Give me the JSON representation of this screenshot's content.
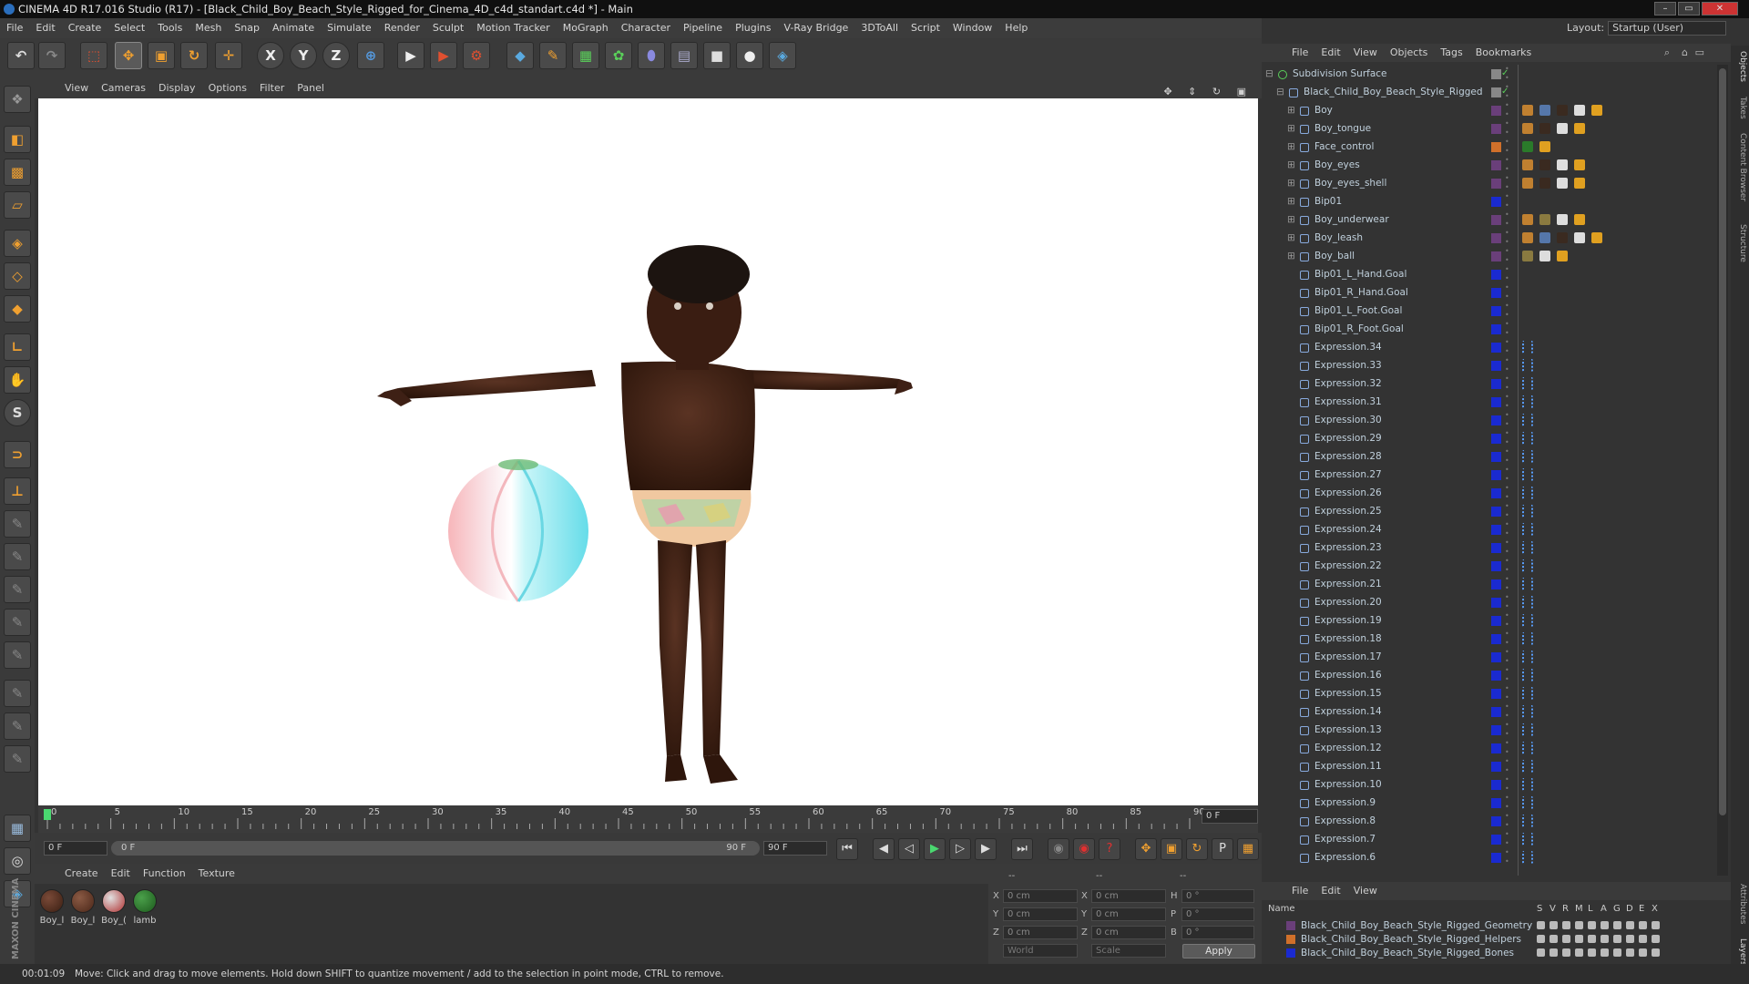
{
  "window": {
    "title": "CINEMA 4D R17.016 Studio (R17) - [Black_Child_Boy_Beach_Style_Rigged_for_Cinema_4D_c4d_standart.c4d *] - Main"
  },
  "menubar": [
    "File",
    "Edit",
    "Create",
    "Select",
    "Tools",
    "Mesh",
    "Snap",
    "Animate",
    "Simulate",
    "Render",
    "Sculpt",
    "Motion Tracker",
    "MoGraph",
    "Character",
    "Pipeline",
    "Plugins",
    "V-Ray Bridge",
    "3DToAll",
    "Script",
    "Window",
    "Help"
  ],
  "layout": {
    "label": "Layout:",
    "value": "Startup (User)"
  },
  "toolbar": {
    "axis_x": "X",
    "axis_y": "Y",
    "axis_z": "Z"
  },
  "viewport_menu": [
    "View",
    "Cameras",
    "Display",
    "Options",
    "Filter",
    "Panel"
  ],
  "timeline": {
    "ticks": [
      "0",
      "5",
      "10",
      "15",
      "20",
      "25",
      "30",
      "35",
      "40",
      "45",
      "50",
      "55",
      "60",
      "65",
      "70",
      "75",
      "80",
      "85",
      "90"
    ],
    "end_frame_field": "0 F"
  },
  "transport": {
    "start_field": "0 F",
    "slider_start": "0 F",
    "slider_end": "90 F",
    "end_field": "90 F"
  },
  "material_menu": [
    "Create",
    "Edit",
    "Function",
    "Texture"
  ],
  "materials": [
    {
      "label": "Boy_l",
      "color": "#3a1e12"
    },
    {
      "label": "Boy_l",
      "color": "#4a2618"
    },
    {
      "label": "Boy_(",
      "color": "#b03030"
    },
    {
      "label": "lamb",
      "color": "#1d5a1d"
    }
  ],
  "coords": {
    "x_label": "X",
    "y_label": "Y",
    "z_label": "Z",
    "pos_x": "0 cm",
    "pos_y": "0 cm",
    "pos_z": "0 cm",
    "size_x": "0 cm",
    "size_y": "0 cm",
    "size_z": "0 cm",
    "h_label": "H",
    "p_label": "P",
    "b_label": "B",
    "rot_h": "0 °",
    "rot_p": "0 °",
    "rot_b": "0 °",
    "mode_world": "World",
    "mode_scale": "Scale",
    "apply": "Apply",
    "header_a": "--",
    "header_b": "--",
    "header_c": "--"
  },
  "object_menu": [
    "File",
    "Edit",
    "View",
    "Objects",
    "Tags",
    "Bookmarks"
  ],
  "objects": [
    {
      "name": "Subdivision Surface",
      "indent": 0,
      "color": "#888888",
      "tags": []
    },
    {
      "name": "Black_Child_Boy_Beach_Style_Rigged",
      "indent": 1,
      "color": "#888888",
      "tags": []
    },
    {
      "name": "Boy",
      "indent": 2,
      "color": "#6a3f7a",
      "tags": [
        "#c08030",
        "#5577aa",
        "#3a2a20",
        "#dddddd",
        "#e0a020"
      ]
    },
    {
      "name": "Boy_tongue",
      "indent": 2,
      "color": "#6a3f7a",
      "tags": [
        "#c08030",
        "#3a2a20",
        "#dddddd",
        "#e0a020"
      ]
    },
    {
      "name": "Face_control",
      "indent": 2,
      "color": "#d0702a",
      "tags": [
        "#2a7a2a",
        "#e0a020"
      ]
    },
    {
      "name": "Boy_eyes",
      "indent": 2,
      "color": "#6a3f7a",
      "tags": [
        "#c08030",
        "#3a2a20",
        "#dddddd",
        "#e0a020"
      ]
    },
    {
      "name": "Boy_eyes_shell",
      "indent": 2,
      "color": "#6a3f7a",
      "tags": [
        "#c08030",
        "#3a2a20",
        "#dddddd",
        "#e0a020"
      ]
    },
    {
      "name": "Bip01",
      "indent": 2,
      "color": "#1a2ad0",
      "tags": []
    },
    {
      "name": "Boy_underwear",
      "indent": 2,
      "color": "#6a3f7a",
      "tags": [
        "#c08030",
        "#8a7a40",
        "#dddddd",
        "#e0a020"
      ]
    },
    {
      "name": "Boy_leash",
      "indent": 2,
      "color": "#6a3f7a",
      "tags": [
        "#c08030",
        "#5577aa",
        "#3a2a20",
        "#dddddd",
        "#e0a020"
      ]
    },
    {
      "name": "Boy_ball",
      "indent": 2,
      "color": "#6a3f7a",
      "tags": [
        "#8a7a40",
        "#dddddd",
        "#e0a020"
      ]
    },
    {
      "name": "Bip01_L_Hand.Goal",
      "indent": 2,
      "color": "#1a2ad0",
      "tags": []
    },
    {
      "name": "Bip01_R_Hand.Goal",
      "indent": 2,
      "color": "#1a2ad0",
      "tags": []
    },
    {
      "name": "Bip01_L_Foot.Goal",
      "indent": 2,
      "color": "#1a2ad0",
      "tags": []
    },
    {
      "name": "Bip01_R_Foot.Goal",
      "indent": 2,
      "color": "#1a2ad0",
      "tags": []
    },
    {
      "name": "Expression.34",
      "indent": 2,
      "color": "#1a2ad0",
      "tags": [
        "xp"
      ]
    },
    {
      "name": "Expression.33",
      "indent": 2,
      "color": "#1a2ad0",
      "tags": [
        "xp"
      ]
    },
    {
      "name": "Expression.32",
      "indent": 2,
      "color": "#1a2ad0",
      "tags": [
        "xp"
      ]
    },
    {
      "name": "Expression.31",
      "indent": 2,
      "color": "#1a2ad0",
      "tags": [
        "xp"
      ]
    },
    {
      "name": "Expression.30",
      "indent": 2,
      "color": "#1a2ad0",
      "tags": [
        "xp"
      ]
    },
    {
      "name": "Expression.29",
      "indent": 2,
      "color": "#1a2ad0",
      "tags": [
        "xp"
      ]
    },
    {
      "name": "Expression.28",
      "indent": 2,
      "color": "#1a2ad0",
      "tags": [
        "xp"
      ]
    },
    {
      "name": "Expression.27",
      "indent": 2,
      "color": "#1a2ad0",
      "tags": [
        "xp"
      ]
    },
    {
      "name": "Expression.26",
      "indent": 2,
      "color": "#1a2ad0",
      "tags": [
        "xp"
      ]
    },
    {
      "name": "Expression.25",
      "indent": 2,
      "color": "#1a2ad0",
      "tags": [
        "xp"
      ]
    },
    {
      "name": "Expression.24",
      "indent": 2,
      "color": "#1a2ad0",
      "tags": [
        "xp"
      ]
    },
    {
      "name": "Expression.23",
      "indent": 2,
      "color": "#1a2ad0",
      "tags": [
        "xp"
      ]
    },
    {
      "name": "Expression.22",
      "indent": 2,
      "color": "#1a2ad0",
      "tags": [
        "xp"
      ]
    },
    {
      "name": "Expression.21",
      "indent": 2,
      "color": "#1a2ad0",
      "tags": [
        "xp"
      ]
    },
    {
      "name": "Expression.20",
      "indent": 2,
      "color": "#1a2ad0",
      "tags": [
        "xp"
      ]
    },
    {
      "name": "Expression.19",
      "indent": 2,
      "color": "#1a2ad0",
      "tags": [
        "xp"
      ]
    },
    {
      "name": "Expression.18",
      "indent": 2,
      "color": "#1a2ad0",
      "tags": [
        "xp"
      ]
    },
    {
      "name": "Expression.17",
      "indent": 2,
      "color": "#1a2ad0",
      "tags": [
        "xp"
      ]
    },
    {
      "name": "Expression.16",
      "indent": 2,
      "color": "#1a2ad0",
      "tags": [
        "xp"
      ]
    },
    {
      "name": "Expression.15",
      "indent": 2,
      "color": "#1a2ad0",
      "tags": [
        "xp"
      ]
    },
    {
      "name": "Expression.14",
      "indent": 2,
      "color": "#1a2ad0",
      "tags": [
        "xp"
      ]
    },
    {
      "name": "Expression.13",
      "indent": 2,
      "color": "#1a2ad0",
      "tags": [
        "xp"
      ]
    },
    {
      "name": "Expression.12",
      "indent": 2,
      "color": "#1a2ad0",
      "tags": [
        "xp"
      ]
    },
    {
      "name": "Expression.11",
      "indent": 2,
      "color": "#1a2ad0",
      "tags": [
        "xp"
      ]
    },
    {
      "name": "Expression.10",
      "indent": 2,
      "color": "#1a2ad0",
      "tags": [
        "xp"
      ]
    },
    {
      "name": "Expression.9",
      "indent": 2,
      "color": "#1a2ad0",
      "tags": [
        "xp"
      ]
    },
    {
      "name": "Expression.8",
      "indent": 2,
      "color": "#1a2ad0",
      "tags": [
        "xp"
      ]
    },
    {
      "name": "Expression.7",
      "indent": 2,
      "color": "#1a2ad0",
      "tags": [
        "xp"
      ]
    },
    {
      "name": "Expression.6",
      "indent": 2,
      "color": "#1a2ad0",
      "tags": [
        "xp"
      ]
    }
  ],
  "layer_menu": [
    "File",
    "Edit",
    "View"
  ],
  "layer_head": {
    "name": "Name",
    "cols": [
      "S",
      "V",
      "R",
      "M",
      "L",
      "A",
      "G",
      "D",
      "E",
      "X"
    ]
  },
  "layers": [
    {
      "name": "Black_Child_Boy_Beach_Style_Rigged_Geometry",
      "color": "#6a3f7a"
    },
    {
      "name": "Black_Child_Boy_Beach_Style_Rigged_Helpers",
      "color": "#d0702a"
    },
    {
      "name": "Black_Child_Boy_Beach_Style_Rigged_Bones",
      "color": "#1a2ad0"
    }
  ],
  "side_tabs": [
    "Objects",
    "Takes",
    "Content Browser",
    "Structure",
    "Attributes",
    "Layers"
  ],
  "status": {
    "time": "00:01:09",
    "message": "Move: Click and drag to move elements. Hold down SHIFT to quantize movement / add to the selection in point mode, CTRL to remove."
  }
}
